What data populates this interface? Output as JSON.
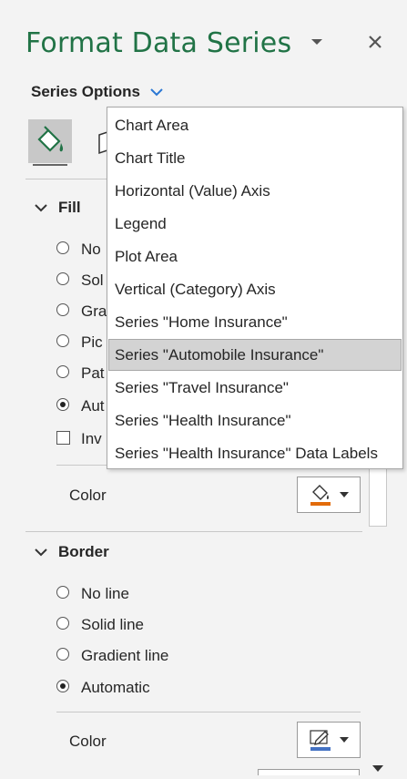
{
  "pane": {
    "title": "Format Data Series",
    "series_options_label": "Series Options"
  },
  "fill": {
    "heading": "Fill",
    "options": [
      {
        "label": "No",
        "selected": false
      },
      {
        "label": "Sol",
        "selected": false
      },
      {
        "label": "Gra",
        "selected": false
      },
      {
        "label": "Pic",
        "selected": false
      },
      {
        "label": "Pat",
        "selected": false
      },
      {
        "label": "Aut",
        "selected": true
      }
    ],
    "invert_label": "Inv",
    "color_label": "Color",
    "color_swatch": "#e26b0a"
  },
  "border": {
    "heading": "Border",
    "options": [
      {
        "label": "No line",
        "selected": false
      },
      {
        "label": "Solid line",
        "selected": false
      },
      {
        "label": "Gradient line",
        "selected": false
      },
      {
        "label": "Automatic",
        "selected": true
      }
    ],
    "color_label": "Color",
    "color_swatch": "#4472c4"
  },
  "dropdown": {
    "items": [
      "Chart Area",
      "Chart Title",
      "Horizontal (Value) Axis",
      "Legend",
      "Plot Area",
      "Vertical (Category) Axis",
      "Series \"Home Insurance\"",
      "Series \"Automobile Insurance\"",
      "Series \"Travel Insurance\"",
      "Series \"Health Insurance\"",
      "Series \"Health Insurance\" Data Labels"
    ],
    "selected_index": 7
  },
  "colors": {
    "accent_green": "#217346",
    "chevron_blue": "#2b78d4"
  }
}
